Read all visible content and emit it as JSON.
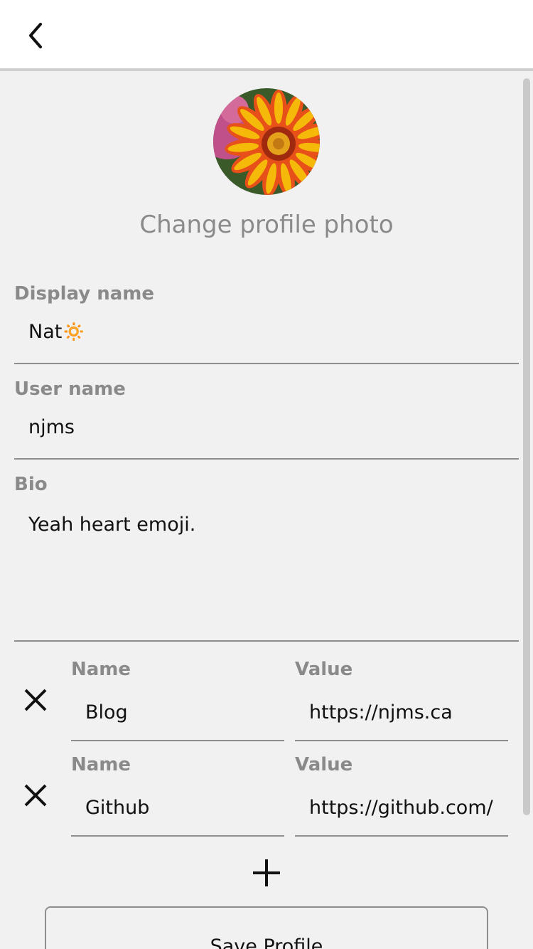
{
  "header": {
    "back_icon": "chevron-left-icon"
  },
  "profile": {
    "avatar_icon": "flower-photo",
    "change_photo_label": "Change profile photo"
  },
  "fields": {
    "display_name": {
      "label": "Display name",
      "value": "Nat🔅"
    },
    "user_name": {
      "label": "User name",
      "value": "njms"
    },
    "bio": {
      "label": "Bio",
      "value": "Yeah heart emoji."
    }
  },
  "metadata": [
    {
      "name_label": "Name",
      "name_value": "Blog",
      "value_label": "Value",
      "value_value": "https://njms.ca"
    },
    {
      "name_label": "Name",
      "name_value": "Github",
      "value_label": "Value",
      "value_value": "https://github.com/njms"
    }
  ],
  "actions": {
    "add_icon": "plus-icon",
    "remove_icon": "close-icon",
    "save_label": "Save Profile"
  },
  "colors": {
    "label": "#8a8a8a",
    "background": "#f1f1f1",
    "header": "#ffffff"
  }
}
